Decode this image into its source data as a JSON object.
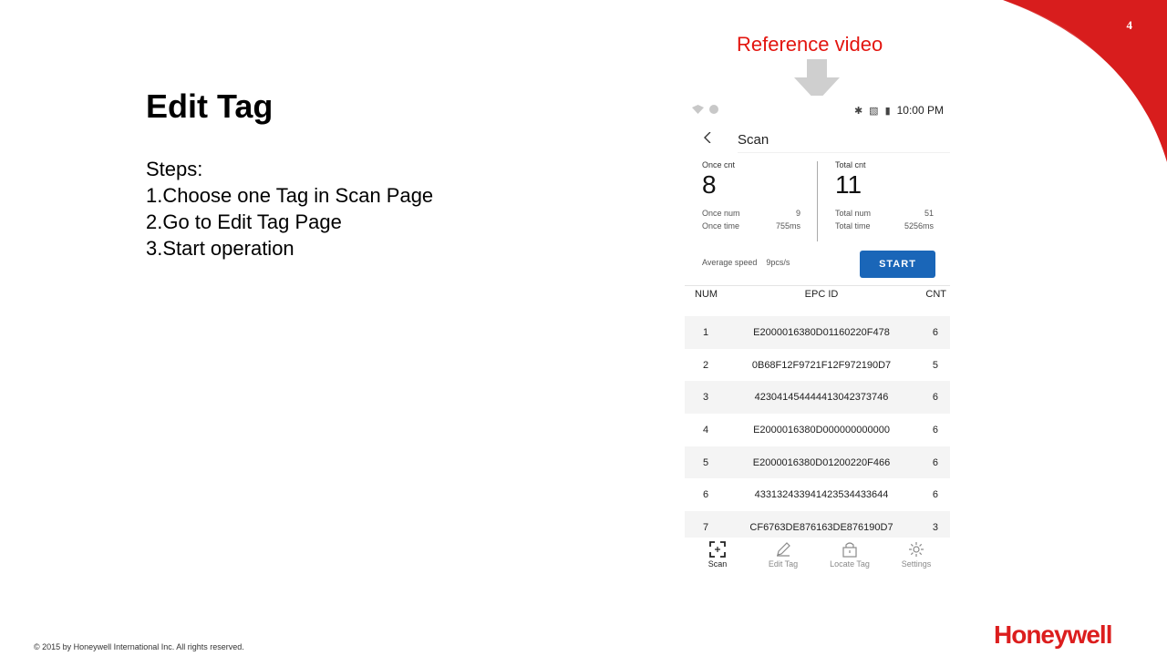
{
  "slide": {
    "title": "Edit Tag",
    "steps": [
      "Steps:",
      "1.Choose one Tag in Scan Page",
      "2.Go to Edit Tag Page",
      "3.Start operation"
    ],
    "page_number": "4",
    "reference_label": "Reference video",
    "copyright": "© 2015 by Honeywell International Inc. All rights reserved.",
    "logo_text": "Honeywell",
    "colors": {
      "accent_red": "#e3150f",
      "logo_red": "#dc1e1e",
      "button_blue": "#1a66b8"
    }
  },
  "phone": {
    "status": {
      "time": "10:00 PM"
    },
    "screen_title": "Scan",
    "stats": {
      "once_cnt_label": "Once cnt",
      "once_cnt_value": "8",
      "total_cnt_label": "Total cnt",
      "total_cnt_value": "11",
      "once_num_label": "Once num",
      "once_num_value": "9",
      "once_time_label": "Once time",
      "once_time_value": "755ms",
      "total_num_label": "Total num",
      "total_num_value": "51",
      "total_time_label": "Total time",
      "total_time_value": "5256ms",
      "avg_speed_label": "Average speed",
      "avg_speed_value": "9pcs/s"
    },
    "start_label": "START",
    "table": {
      "headers": {
        "num": "NUM",
        "epc": "EPC ID",
        "cnt": "CNT"
      },
      "rows": [
        {
          "num": "1",
          "epc": "E2000016380D01160220F478",
          "cnt": "6"
        },
        {
          "num": "2",
          "epc": "0B68F12F9721F12F972190D7",
          "cnt": "5"
        },
        {
          "num": "3",
          "epc": "423041454444413042373746",
          "cnt": "6"
        },
        {
          "num": "4",
          "epc": "E2000016380D000000000000",
          "cnt": "6"
        },
        {
          "num": "5",
          "epc": "E2000016380D01200220F466",
          "cnt": "6"
        },
        {
          "num": "6",
          "epc": "433132433941423534433644",
          "cnt": "6"
        },
        {
          "num": "7",
          "epc": "CF6763DE876163DE876190D7",
          "cnt": "3"
        }
      ]
    },
    "nav": [
      {
        "label": "Scan",
        "icon": "scan-icon"
      },
      {
        "label": "Edit Tag",
        "icon": "pencil-icon"
      },
      {
        "label": "Locate Tag",
        "icon": "lock-icon"
      },
      {
        "label": "Settings",
        "icon": "gear-icon"
      }
    ]
  }
}
